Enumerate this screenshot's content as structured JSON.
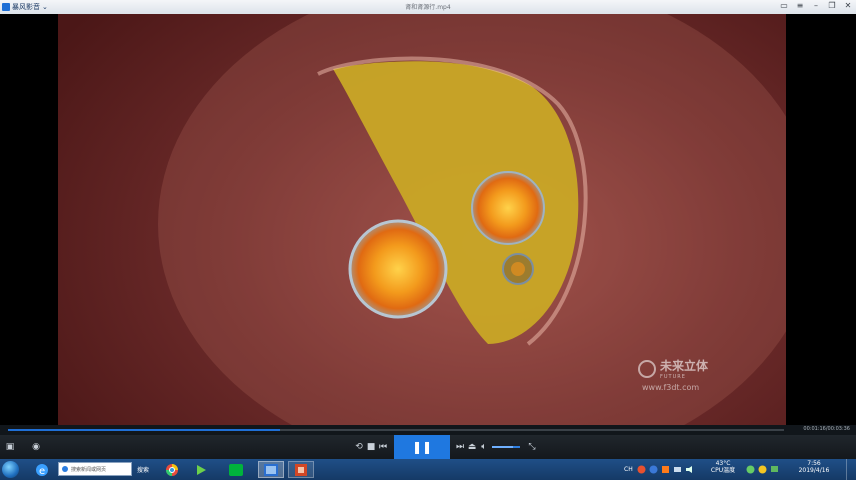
{
  "app": {
    "menu_label": "暴风影音",
    "window_title": "肾和肾源行.mp4"
  },
  "watermark": {
    "brand": "未来立体",
    "brand_sub": "FUTURE",
    "url": "www.f3dt.com"
  },
  "player": {
    "time": "00:01:16/00:03:36",
    "progress_fraction": 0.35,
    "volume_fraction": 0.75,
    "colors": {
      "accent": "#1f78e0"
    }
  },
  "taskbar": {
    "search_placeholder": "搜索新闻或网页",
    "search_button": "搜索",
    "tray": {
      "ime": "CH",
      "temp": "43°C",
      "temp_label": "CPU温度",
      "time": "7:56",
      "date": "2019/4/16"
    }
  }
}
